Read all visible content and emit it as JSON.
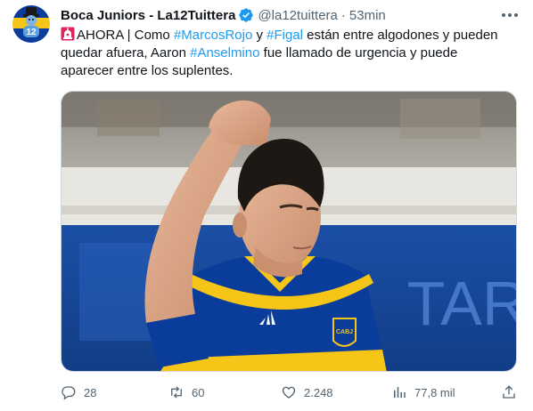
{
  "author": {
    "name": "Boca Juniors - La12Tuittera",
    "handle": "@la12tuittera",
    "separator": "·",
    "time": "53min",
    "verified": true,
    "avatar_text": "12"
  },
  "tweet": {
    "line1_intro": "AHORA | Como ",
    "hashtag_rojo": "#MarcosRojo",
    "line1_mid": " y ",
    "hashtag_figal": "#Figal",
    "line1_end": " están entre algodones y pueden",
    "line2_start": "quedar afuera, Aaron ",
    "hashtag_anselmino": "#Anselmino",
    "line2_end": " fue llamado de urgencia y puede",
    "line3": "aparecer entre los suplentes.",
    "media": {
      "jersey_text": "CABJ",
      "ad_board_text": "TAR"
    }
  },
  "actions": {
    "replies": "28",
    "retweets": "60",
    "likes": "2.248",
    "views": "77,8 mil"
  },
  "icons": {
    "more": "more-icon",
    "alarm": "siren-icon",
    "verified": "verified-badge-icon",
    "reply": "reply-icon",
    "retweet": "retweet-icon",
    "like": "heart-icon",
    "views": "views-icon",
    "share": "share-icon"
  },
  "colors": {
    "link": "#1d9bf0",
    "secondary": "#536471",
    "text": "#0f1419",
    "boca_blue": "#0a3c9c",
    "boca_gold": "#f5c518"
  }
}
